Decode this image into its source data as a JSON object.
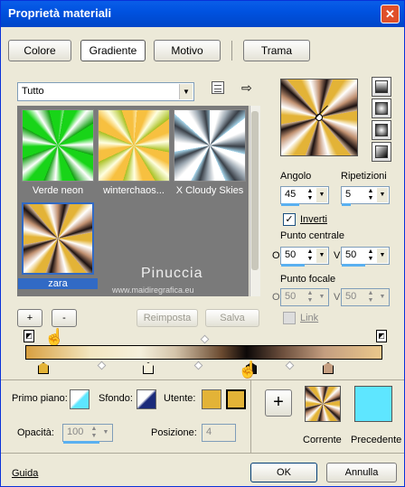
{
  "window": {
    "title": "Proprietà materiali",
    "close": "✕"
  },
  "tabs": [
    {
      "label": "Colore"
    },
    {
      "label": "Gradiente"
    },
    {
      "label": "Motivo"
    },
    {
      "label": "Trama"
    }
  ],
  "library": {
    "category": "Tutto"
  },
  "thumbs": [
    {
      "caption": "Verde neon"
    },
    {
      "caption": "winterchaos..."
    },
    {
      "caption": "X Cloudy Skies"
    },
    {
      "caption": "zara"
    }
  ],
  "watermark": {
    "name": "Pinuccia",
    "site": "www.maidiregrafica.eu"
  },
  "buttons": {
    "add": "+",
    "remove": "-",
    "reset": "Reimposta",
    "save": "Salva",
    "plus": "+",
    "ok": "OK",
    "cancel": "Annulla"
  },
  "gradient": {
    "angle_label": "Angolo",
    "angle": "45",
    "repeat_label": "Ripetizioni",
    "repeat": "5",
    "invert_label": "Inverti",
    "invert_checked": true,
    "center_label": "Punto centrale",
    "center_o": "50",
    "center_v": "50",
    "focal_label": "Punto focale",
    "focal_o": "50",
    "focal_v": "50",
    "link_label": "Link",
    "o": "O",
    "v": "V"
  },
  "bottom": {
    "fg_label": "Primo piano:",
    "bg_label": "Sfondo:",
    "user_label": "Utente:",
    "opacity_label": "Opacità:",
    "opacity": "100",
    "position_label": "Posizione:",
    "position": "4",
    "current": "Corrente",
    "previous": "Precedente",
    "help": "Guida"
  },
  "colors": {
    "accent": "#316ac5",
    "user": "#e3b337",
    "previous": "#5ee6ff"
  }
}
